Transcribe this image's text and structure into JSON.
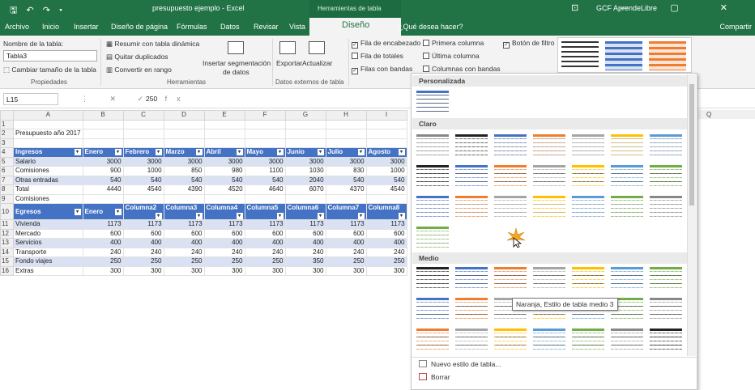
{
  "titlebar": {
    "qat": "🖫 ↶ ↷ ▾",
    "title": "presupuesto ejemplo  -  Excel",
    "contextual": "Herramientas de tabla",
    "user": "GCF AprendeLibre",
    "winbtns": "⊡ — ▢ ✕"
  },
  "tabs": [
    "Archivo",
    "Inicio",
    "Insertar",
    "Diseño de página",
    "Fórmulas",
    "Datos",
    "Revisar",
    "Vista"
  ],
  "active_tab": "Diseño",
  "tell_me": "¿Qué desea hacer?",
  "share": "Compartir",
  "ribbon": {
    "table_name_label": "Nombre de la tabla:",
    "table_name_value": "Tabla3",
    "resize": "Cambiar tamaño de la tabla",
    "group_props": "Propiedades",
    "summarize": "Resumir con tabla dinámica",
    "remove_dupes": "Quitar duplicados",
    "convert_range": "Convertir en rango",
    "insert_slicer_1": "Insertar segmentación",
    "insert_slicer_2": "de datos",
    "group_tools": "Herramientas",
    "export": "Exportar",
    "refresh": "Actualizar",
    "group_external": "Datos externos de tabla",
    "header_row": "Fila de encabezado",
    "total_row": "Fila de totales",
    "banded_rows": "Filas con bandas",
    "first_col": "Primera columna",
    "last_col": "Última columna",
    "banded_cols": "Columnas con bandas",
    "filter_btn": "Botón de filtro"
  },
  "formula": {
    "cell": "L15",
    "icons": "⋮ ✕ ✓ fx",
    "value": "250"
  },
  "columns": [
    "A",
    "B",
    "C",
    "D",
    "E",
    "F",
    "G",
    "H",
    "I"
  ],
  "right_col": "Q",
  "rows": [
    {
      "n": "1",
      "cells": [
        "",
        "",
        "",
        "",
        "",
        "",
        "",
        "",
        ""
      ]
    },
    {
      "n": "2",
      "cells": [
        "Presupuesto año 2017",
        "",
        "",
        "",
        "",
        "",
        "",
        "",
        ""
      ]
    },
    {
      "n": "3",
      "cells": [
        "",
        "",
        "",
        "",
        "",
        "",
        "",
        "",
        ""
      ]
    },
    {
      "n": "4",
      "cells": [
        "Ingresos",
        "Enero",
        "Febrero",
        "Marzo",
        "Abril",
        "Mayo",
        "Junio",
        "Julio",
        "Agosto"
      ]
    },
    {
      "n": "5",
      "cells": [
        "Salario",
        "3000",
        "3000",
        "3000",
        "3000",
        "3000",
        "3000",
        "3000",
        "3000"
      ]
    },
    {
      "n": "6",
      "cells": [
        "Comisiones",
        "900",
        "1000",
        "850",
        "980",
        "1100",
        "1030",
        "830",
        "1000"
      ]
    },
    {
      "n": "7",
      "cells": [
        "Otras entradas",
        "540",
        "540",
        "540",
        "540",
        "540",
        "2040",
        "540",
        "540"
      ]
    },
    {
      "n": "8",
      "cells": [
        "Total",
        "4440",
        "4540",
        "4390",
        "4520",
        "4640",
        "6070",
        "4370",
        "4540"
      ]
    },
    {
      "n": "9",
      "cells": [
        "Comisiones",
        "",
        "",
        "",
        "",
        "",
        "",
        "",
        ""
      ]
    },
    {
      "n": "10",
      "cells": [
        "Egresos",
        "Enero",
        "Columna2",
        "Columna3",
        "Columna4",
        "Columna5",
        "Columna6",
        "Columna7",
        "Columna8"
      ]
    },
    {
      "n": "11",
      "cells": [
        "Vivienda",
        "1173",
        "1173",
        "1173",
        "1173",
        "1173",
        "1173",
        "1173",
        "1173"
      ]
    },
    {
      "n": "12",
      "cells": [
        "Mercado",
        "600",
        "600",
        "600",
        "600",
        "600",
        "600",
        "600",
        "600"
      ]
    },
    {
      "n": "13",
      "cells": [
        "Servicios",
        "400",
        "400",
        "400",
        "400",
        "400",
        "400",
        "400",
        "400"
      ]
    },
    {
      "n": "14",
      "cells": [
        "Transporte",
        "240",
        "240",
        "240",
        "240",
        "240",
        "240",
        "240",
        "240"
      ]
    },
    {
      "n": "15",
      "cells": [
        "Fondo viajes",
        "250",
        "250",
        "250",
        "250",
        "250",
        "350",
        "250",
        "250"
      ]
    },
    {
      "n": "16",
      "cells": [
        "Extras",
        "300",
        "300",
        "300",
        "300",
        "300",
        "300",
        "300",
        "300"
      ]
    }
  ],
  "gallery": {
    "custom": "Personalizada",
    "light": "Claro",
    "medium": "Medio",
    "tooltip": "Naranja, Estilo de tabla medio 3",
    "new_style": "Nuevo estilo de tabla...",
    "clear": "Borrar"
  },
  "colors": {
    "excel_green": "#217346",
    "table_blue": "#4472c4",
    "band_blue": "#d9e1f2",
    "light_palette": [
      "#888888",
      "#222222",
      "#4472c4",
      "#ed7d31",
      "#a5a5a5",
      "#ffc000",
      "#5b9bd5",
      "#70ad47"
    ]
  }
}
